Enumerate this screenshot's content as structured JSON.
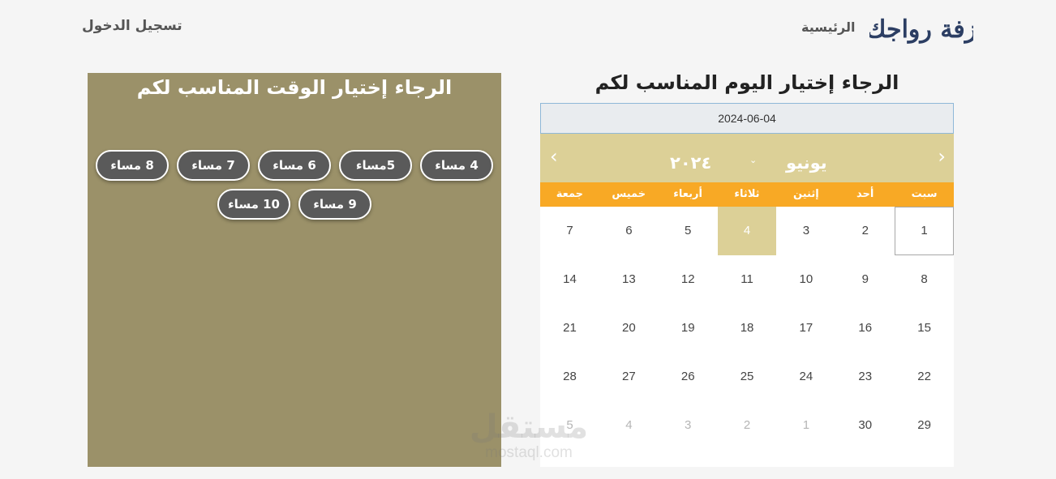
{
  "header": {
    "login_label": "تسجيل الدخول",
    "home_label": "الرئيسية",
    "logo_text": "زفة رواجك",
    "logo_color": "#2c3e63"
  },
  "date_section": {
    "title": "الرجاء إختيار اليوم المناسب لكم",
    "selected_date": "2024-06-04",
    "calendar": {
      "month": "يونيو",
      "year": "٢٠٢٤",
      "prev_icon": "‹",
      "next_icon": "›",
      "caret": "⌄",
      "weekdays": [
        "سبت",
        "أحد",
        "إثنين",
        "ثلاثاء",
        "أربعاء",
        "خميس",
        "جمعة"
      ],
      "days": [
        {
          "label": "1",
          "state": "today"
        },
        {
          "label": "2",
          "state": ""
        },
        {
          "label": "3",
          "state": ""
        },
        {
          "label": "4",
          "state": "selected"
        },
        {
          "label": "5",
          "state": ""
        },
        {
          "label": "6",
          "state": ""
        },
        {
          "label": "7",
          "state": ""
        },
        {
          "label": "8",
          "state": ""
        },
        {
          "label": "9",
          "state": ""
        },
        {
          "label": "10",
          "state": ""
        },
        {
          "label": "11",
          "state": ""
        },
        {
          "label": "12",
          "state": ""
        },
        {
          "label": "13",
          "state": ""
        },
        {
          "label": "14",
          "state": ""
        },
        {
          "label": "15",
          "state": ""
        },
        {
          "label": "16",
          "state": ""
        },
        {
          "label": "17",
          "state": ""
        },
        {
          "label": "18",
          "state": ""
        },
        {
          "label": "19",
          "state": ""
        },
        {
          "label": "20",
          "state": ""
        },
        {
          "label": "21",
          "state": ""
        },
        {
          "label": "22",
          "state": ""
        },
        {
          "label": "23",
          "state": ""
        },
        {
          "label": "24",
          "state": ""
        },
        {
          "label": "25",
          "state": ""
        },
        {
          "label": "26",
          "state": ""
        },
        {
          "label": "27",
          "state": ""
        },
        {
          "label": "28",
          "state": ""
        },
        {
          "label": "29",
          "state": ""
        },
        {
          "label": "30",
          "state": ""
        },
        {
          "label": "1",
          "state": "muted"
        },
        {
          "label": "2",
          "state": "muted"
        },
        {
          "label": "3",
          "state": "muted"
        },
        {
          "label": "4",
          "state": "muted"
        },
        {
          "label": "5",
          "state": "muted"
        }
      ]
    },
    "colors": {
      "header_bg": "#dcd097",
      "weekday_bg": "#f8a925",
      "selected_bg": "#dcd097"
    }
  },
  "time_section": {
    "title": "الرجاء إختيار الوقت المناسب لكم",
    "slots": [
      "4 مساء",
      "5مساء",
      "6 مساء",
      "7 مساء",
      "8 مساء",
      "9 مساء",
      "10 مساء"
    ],
    "colors": {
      "panel_bg": "#9b9169",
      "slot_bg": "#5a5a5a"
    }
  },
  "watermark": {
    "main": "مستقل",
    "sub": "mostaql.com"
  }
}
